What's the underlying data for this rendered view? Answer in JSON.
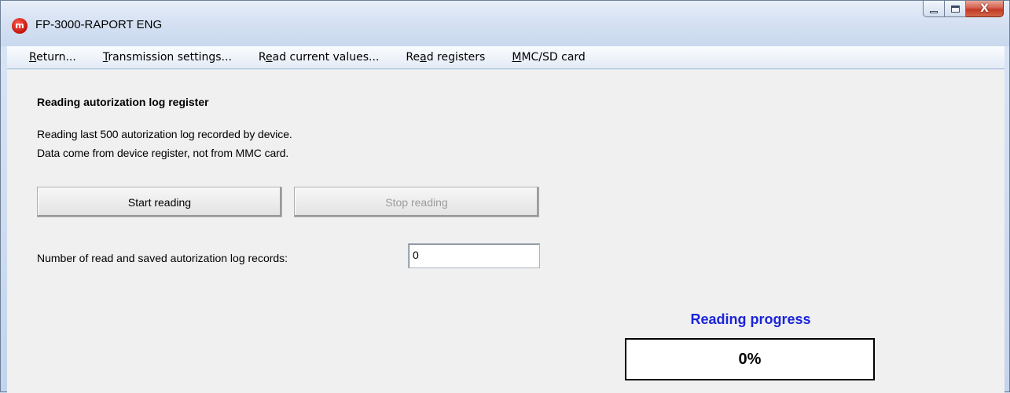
{
  "window": {
    "title": "FP-3000-RAPORT ENG",
    "icon_letter": "m",
    "icon": "app-logo-icon",
    "controls": {
      "minimize_icon": "minimize-icon",
      "maximize_icon": "maximize-icon",
      "close_icon": "close-icon",
      "close_glyph": "X",
      "close_color": "#c23a24"
    }
  },
  "menu": {
    "items": [
      {
        "pre": "",
        "key": "R",
        "post": "eturn..."
      },
      {
        "pre": "",
        "key": "T",
        "post": "ransmission settings..."
      },
      {
        "pre": "R",
        "key": "e",
        "post": "ad current values..."
      },
      {
        "pre": "Re",
        "key": "a",
        "post": "d registers"
      },
      {
        "pre": "",
        "key": "M",
        "post": "MC/SD card"
      }
    ]
  },
  "panel": {
    "heading": "Reading autorization log register",
    "description_line1": "Reading last 500 autorization log recorded by device.",
    "description_line2": "Data come from device register, not from MMC card.",
    "start_button": "Start reading",
    "stop_button": "Stop reading",
    "stop_enabled": false,
    "records_label": "Number of read and saved autorization log records:",
    "records_value": "0"
  },
  "progress": {
    "title": "Reading progress",
    "title_color": "#1a24d8",
    "percent": 0,
    "display": "0%"
  }
}
